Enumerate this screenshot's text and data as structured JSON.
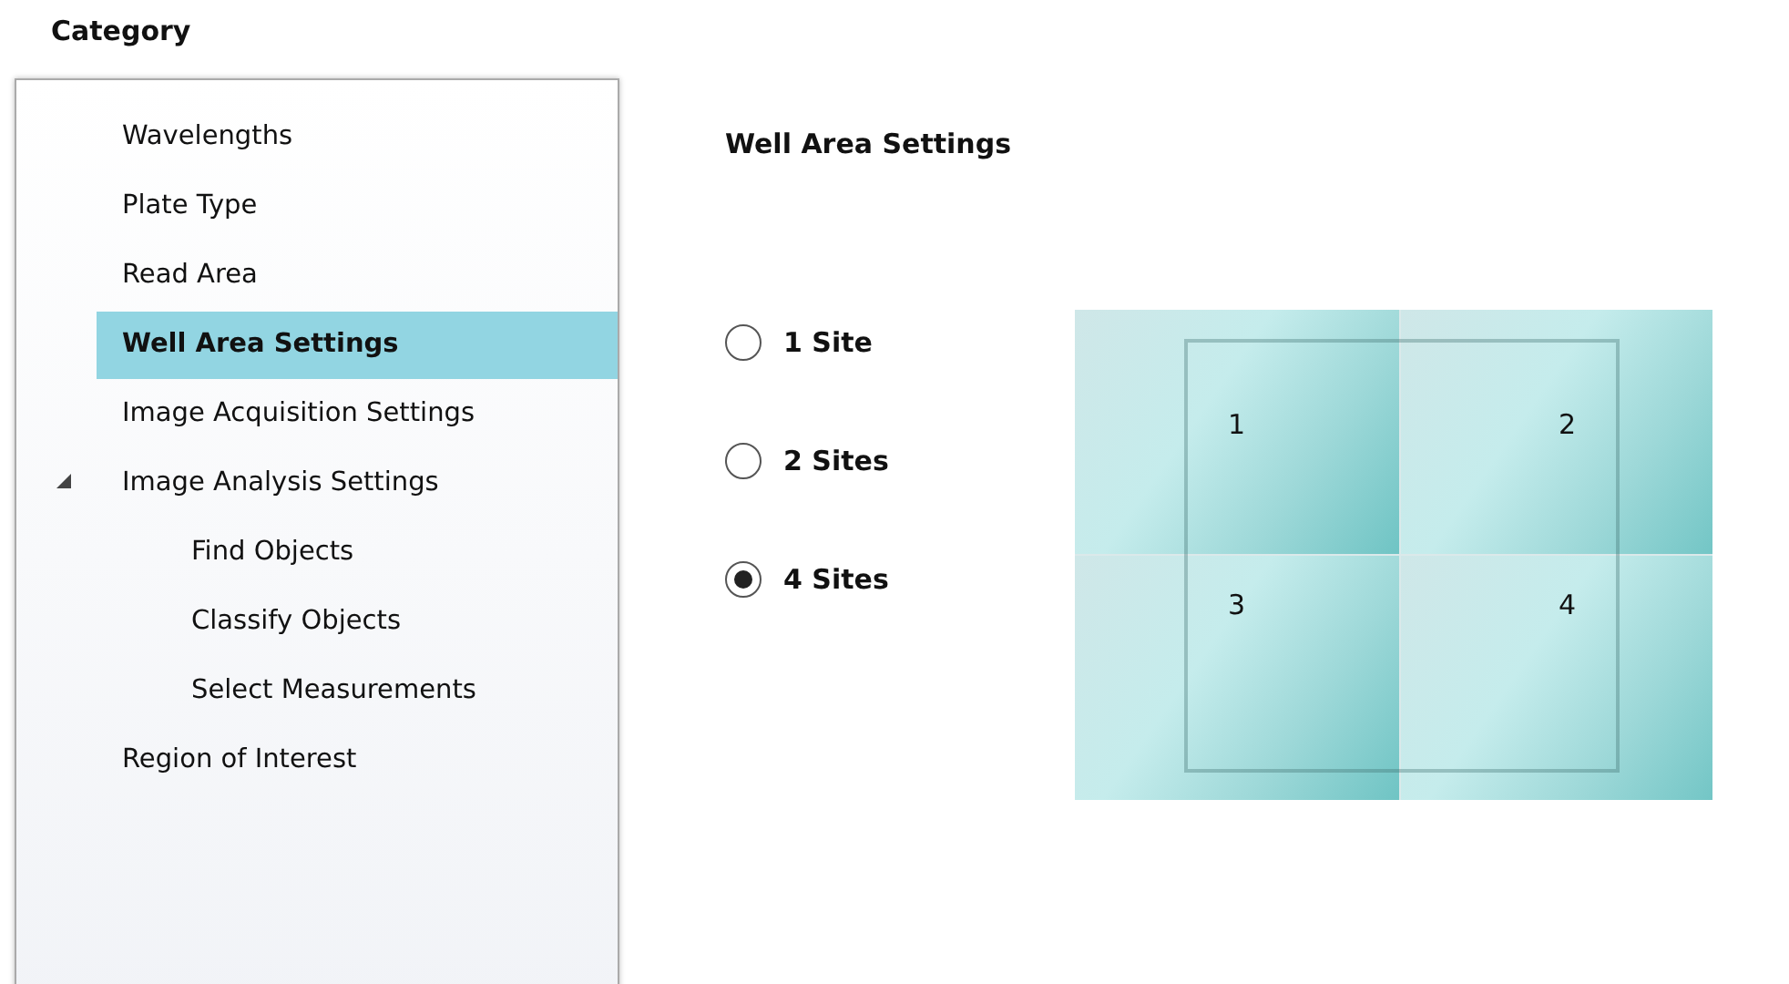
{
  "category": {
    "title": "Category",
    "items": [
      {
        "label": "Wavelengths",
        "selected": false
      },
      {
        "label": "Plate Type",
        "selected": false
      },
      {
        "label": "Read Area",
        "selected": false
      },
      {
        "label": "Well Area Settings",
        "selected": true
      },
      {
        "label": "Image Acquisition Settings",
        "selected": false
      },
      {
        "label": "Image Analysis Settings",
        "selected": false,
        "expanded": true,
        "children": [
          {
            "label": "Find Objects",
            "selected": false
          },
          {
            "label": "Classify Objects",
            "selected": false
          },
          {
            "label": "Select Measurements",
            "selected": false
          }
        ]
      },
      {
        "label": "Region of Interest",
        "selected": false
      }
    ]
  },
  "settings": {
    "title": "Well Area Settings",
    "options": [
      {
        "label": "1 Site",
        "selected": false
      },
      {
        "label": "2 Sites",
        "selected": false
      },
      {
        "label": "4 Sites",
        "selected": true
      }
    ],
    "sites": [
      "1",
      "2",
      "3",
      "4"
    ]
  }
}
